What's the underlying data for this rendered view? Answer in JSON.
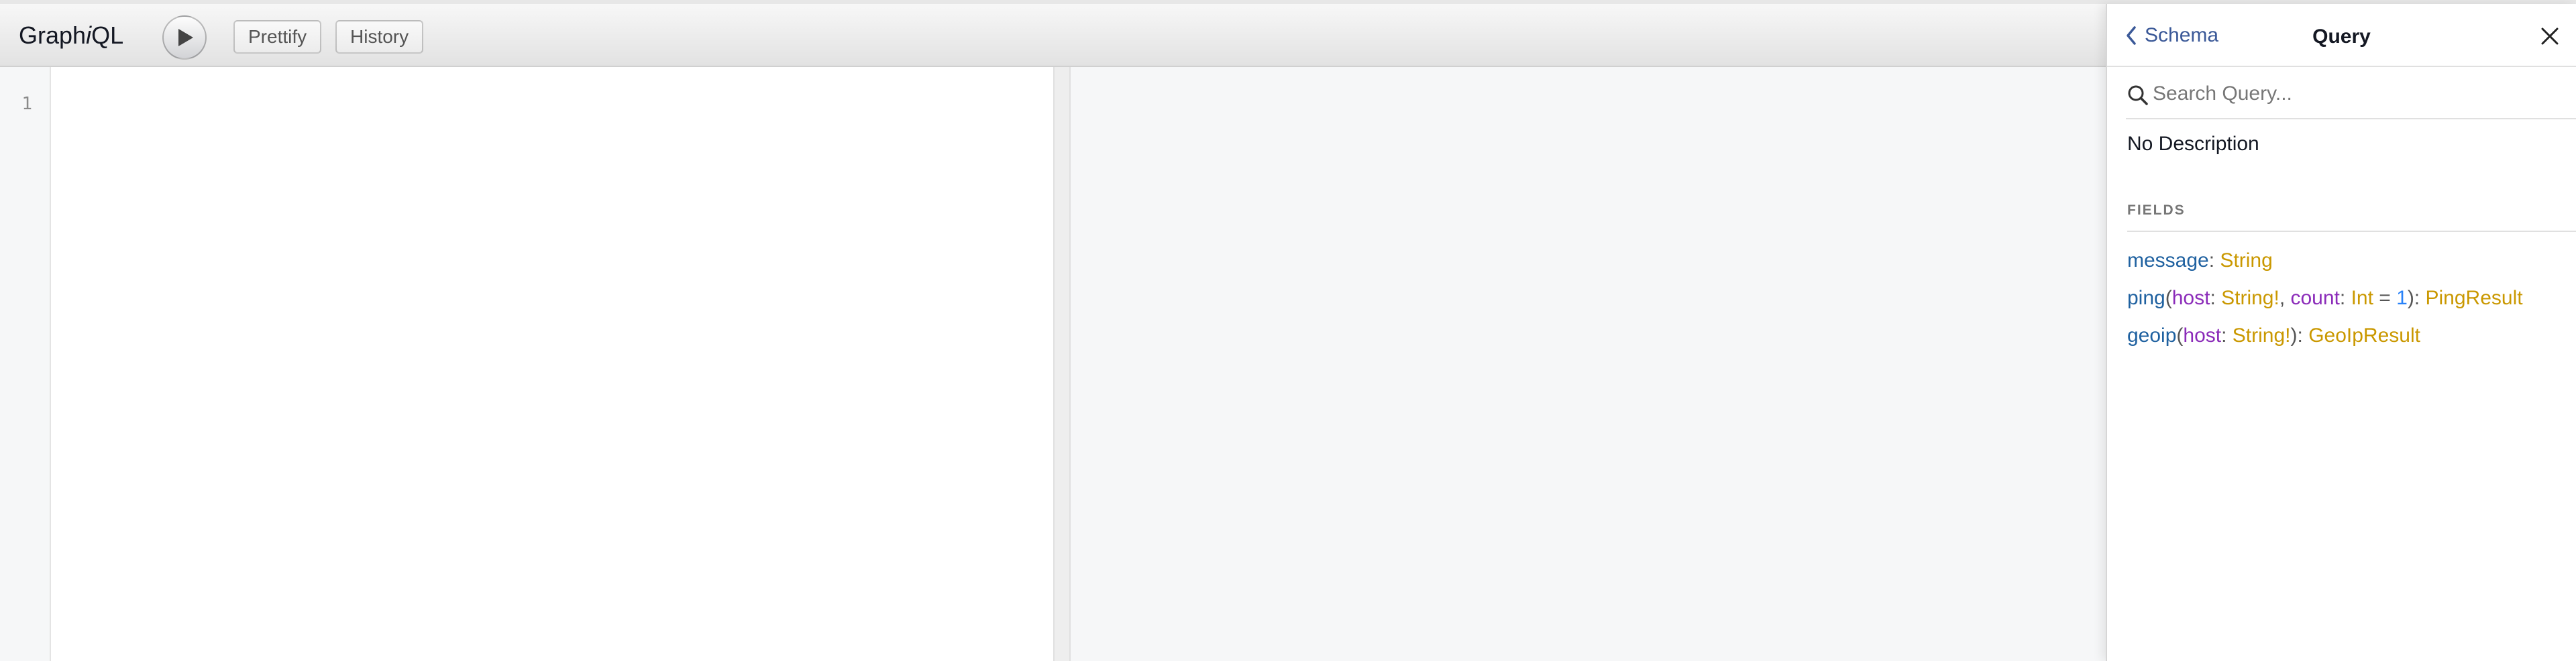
{
  "app": {
    "title_prefix": "Graph",
    "title_italic": "i",
    "title_suffix": "QL"
  },
  "toolbar": {
    "execute_icon": "play-icon",
    "prettify_label": "Prettify",
    "history_label": "History"
  },
  "editor": {
    "line_numbers": [
      "1"
    ]
  },
  "docs": {
    "back_label": "Schema",
    "title": "Query",
    "search_placeholder": "Search Query...",
    "description": "No Description",
    "fields_label": "FIELDS",
    "fields": [
      {
        "name": "message",
        "type": "String"
      },
      {
        "name": "ping",
        "args": [
          {
            "name": "host",
            "type": "String!"
          },
          {
            "name": "count",
            "type": "Int",
            "default": "1"
          }
        ],
        "type": "PingResult"
      },
      {
        "name": "geoip",
        "args": [
          {
            "name": "host",
            "type": "String!"
          }
        ],
        "type": "GeoIpResult"
      }
    ]
  },
  "colors": {
    "field_name": "#1f61a0",
    "arg_name": "#8b2bb9",
    "type_name": "#ca9800",
    "default_value": "#2882f9",
    "link": "#3b5998"
  }
}
